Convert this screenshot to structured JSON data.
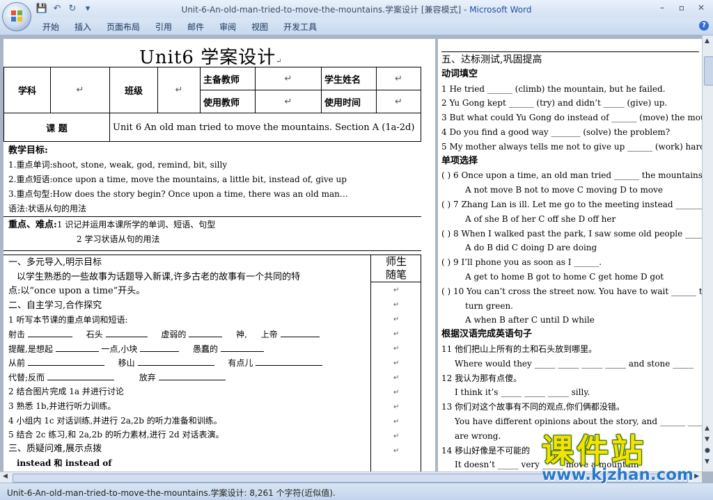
{
  "window": {
    "title_doc": "Unit-6-An-old-man-tried-to-move-the-mountains.学案设计 [兼容模式] - ",
    "title_app": "Microsoft Word",
    "controls": {
      "minimize": "–",
      "restore": "▫",
      "close": "✕"
    }
  },
  "quick_access": {
    "save_icon": "💾",
    "undo_icon": "↶",
    "redo_icon": "↻",
    "more_icon": "▾"
  },
  "ribbon": {
    "tabs": [
      "开始",
      "插入",
      "页面布局",
      "引用",
      "邮件",
      "审阅",
      "视图",
      "开发工具"
    ],
    "help": "?"
  },
  "status": {
    "text": "Unit-6-An-old-man-tried-to-move-the-mountains.学案设计: 8,261 个字符(近似值)."
  },
  "left_page": {
    "title": "Unit6 学案设计",
    "mark": "↵",
    "table": {
      "subject_label": "学科",
      "class_label": "班级",
      "main_teacher_label": "主备教师",
      "student_name_label": "学生姓名",
      "using_teacher_label": "使用教师",
      "using_time_label": "使用时间",
      "topic_label": "课  题",
      "topic_value": "Unit 6 An old man tried to move the mountains. Section A (1a-2d)"
    },
    "goals": {
      "heading": "教学目标:",
      "lines": [
        "1.重点单词:shoot, stone, weak, god, remind, bit, silly",
        "2.重点短语:once upon a time, move the mountains, a little bit, instead of, give up",
        "3.重点句型:How does the story begin? Once upon a time, there was an old man…",
        "语法:状语从句的用法"
      ]
    },
    "key_points": {
      "heading": "重点、难点:",
      "line1": "1 识记并运用本课所学的单词、短语、句型",
      "line2": "2 学习状语从句的用法"
    },
    "side_header": [
      "师生",
      "随笔"
    ],
    "body": {
      "s1_heading": "一、多元导入,明示目标",
      "s1_text_a": "以学生熟悉的一些故事为话题导入新课,许多古老的故事有一个共同的特",
      "s1_text_b": "点:以“once upon a time”开头。",
      "s2_heading": "二、自主学习,合作探究",
      "s2_item1": "1 听写本节课的重点单词和短语:",
      "vocab": [
        [
          "射击",
          "石头",
          "虚弱的",
          "神,",
          "上帝"
        ],
        [
          "提醒,是想起",
          "一点,小块",
          "愚蠢的"
        ],
        [
          "从前",
          "移山",
          "有点儿"
        ],
        [
          "代替;反而",
          "放弃"
        ]
      ],
      "s2_item2": "2 结合图片完成 1a 并进行讨论",
      "s2_item3": "3 熟悉 1b,并进行听力训练。",
      "s2_item4": "4 小组内 1c 对话训练,并进行 2a,2b 的听力准备和训练。",
      "s2_item5": "5 结合 2c 练习,和 2a,2b 的听力素材,进行 2d 对话表演。",
      "s3_heading": "三、质疑问难,展示点拨",
      "s3_item": "instead 和 instead of"
    }
  },
  "right_page": {
    "heading": "五、达标测试,巩固提高",
    "verb_heading": "动词填空",
    "verb_items": [
      "1 He tried ______ (climb) the mountain, but he failed.",
      "2 Yu Gong kept ______ (try) and didn’t _____ (give) up.",
      "3 But what could Yu Gong do instead of ______ (move) the mount",
      "4 Do you find a good way _______ (solve) the problem?",
      "5 My mother always tells me not to give up ______ (work) hard."
    ],
    "choice_heading": "单项选择",
    "choice_items": [
      {
        "q": "(   ) 6 Once upon a time, an old man tried ______ the mountains.",
        "opts": "A not move     B not to move     C moving     D to move"
      },
      {
        "q": "(   ) 7 Zhang Lan is ill. Let me go to the meeting instead _________",
        "opts": "A of she     B of her     C off she     D off her"
      },
      {
        "q": "(   ) 8 When I walked past the park, I saw some old people ______",
        "opts": "A do     B did     C doing     D are doing"
      },
      {
        "q": "(   ) 9 I’ll phone you as soon as I ______.",
        "opts": "A get to home     B got to home     C get home     D got"
      },
      {
        "q": "(   ) 10 You can’t cross the street now. You have to wait ______ the",
        "opts": "turn green.",
        "opts2": "A when     B after     C until     D while"
      }
    ],
    "trans_heading": "根据汉语完成英语句子",
    "trans_items": [
      {
        "cn": "11 他们把山上所有的土和石头放到哪里。",
        "en": "Where would they _____ _____ _____ _____ and stone _____"
      },
      {
        "cn": "12 我认为那有点傻。",
        "en": "I think it’s _____ _____ _____ silly."
      },
      {
        "cn": "13 你们对这个故事有不同的观点,你们俩都没错。",
        "en": "You have different opinions about the story, and ______ _____",
        "en2": "are wrong."
      },
      {
        "cn": "14 移山好像是不可能的",
        "en": "It doesn’t _____ very _____ move a mountain"
      }
    ]
  },
  "watermark": {
    "text": "课件站",
    "url": "www.kjzhan.com"
  }
}
